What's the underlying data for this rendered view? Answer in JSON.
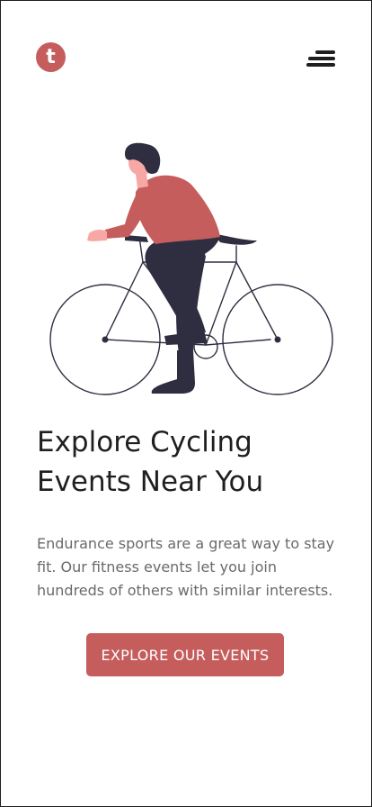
{
  "brand": {
    "logo_letter": "t",
    "accent_color": "#c65d5d"
  },
  "header": {
    "menu_icon": "hamburger-menu-icon"
  },
  "hero": {
    "illustration": "cyclist-on-bicycle-illustration",
    "title_line1": "Explore Cycling",
    "title_line2": "Events Near You",
    "description": "Endurance sports are a great way to stay fit. Our fitness events let you join hundreds of others with similar interests.",
    "cta_label": "EXPLORE OUR EVENTS"
  },
  "colors": {
    "text": "#1f1f1f",
    "muted_text": "#6a6a6a",
    "accent": "#c65d5d",
    "pants": "#2f2e41"
  }
}
